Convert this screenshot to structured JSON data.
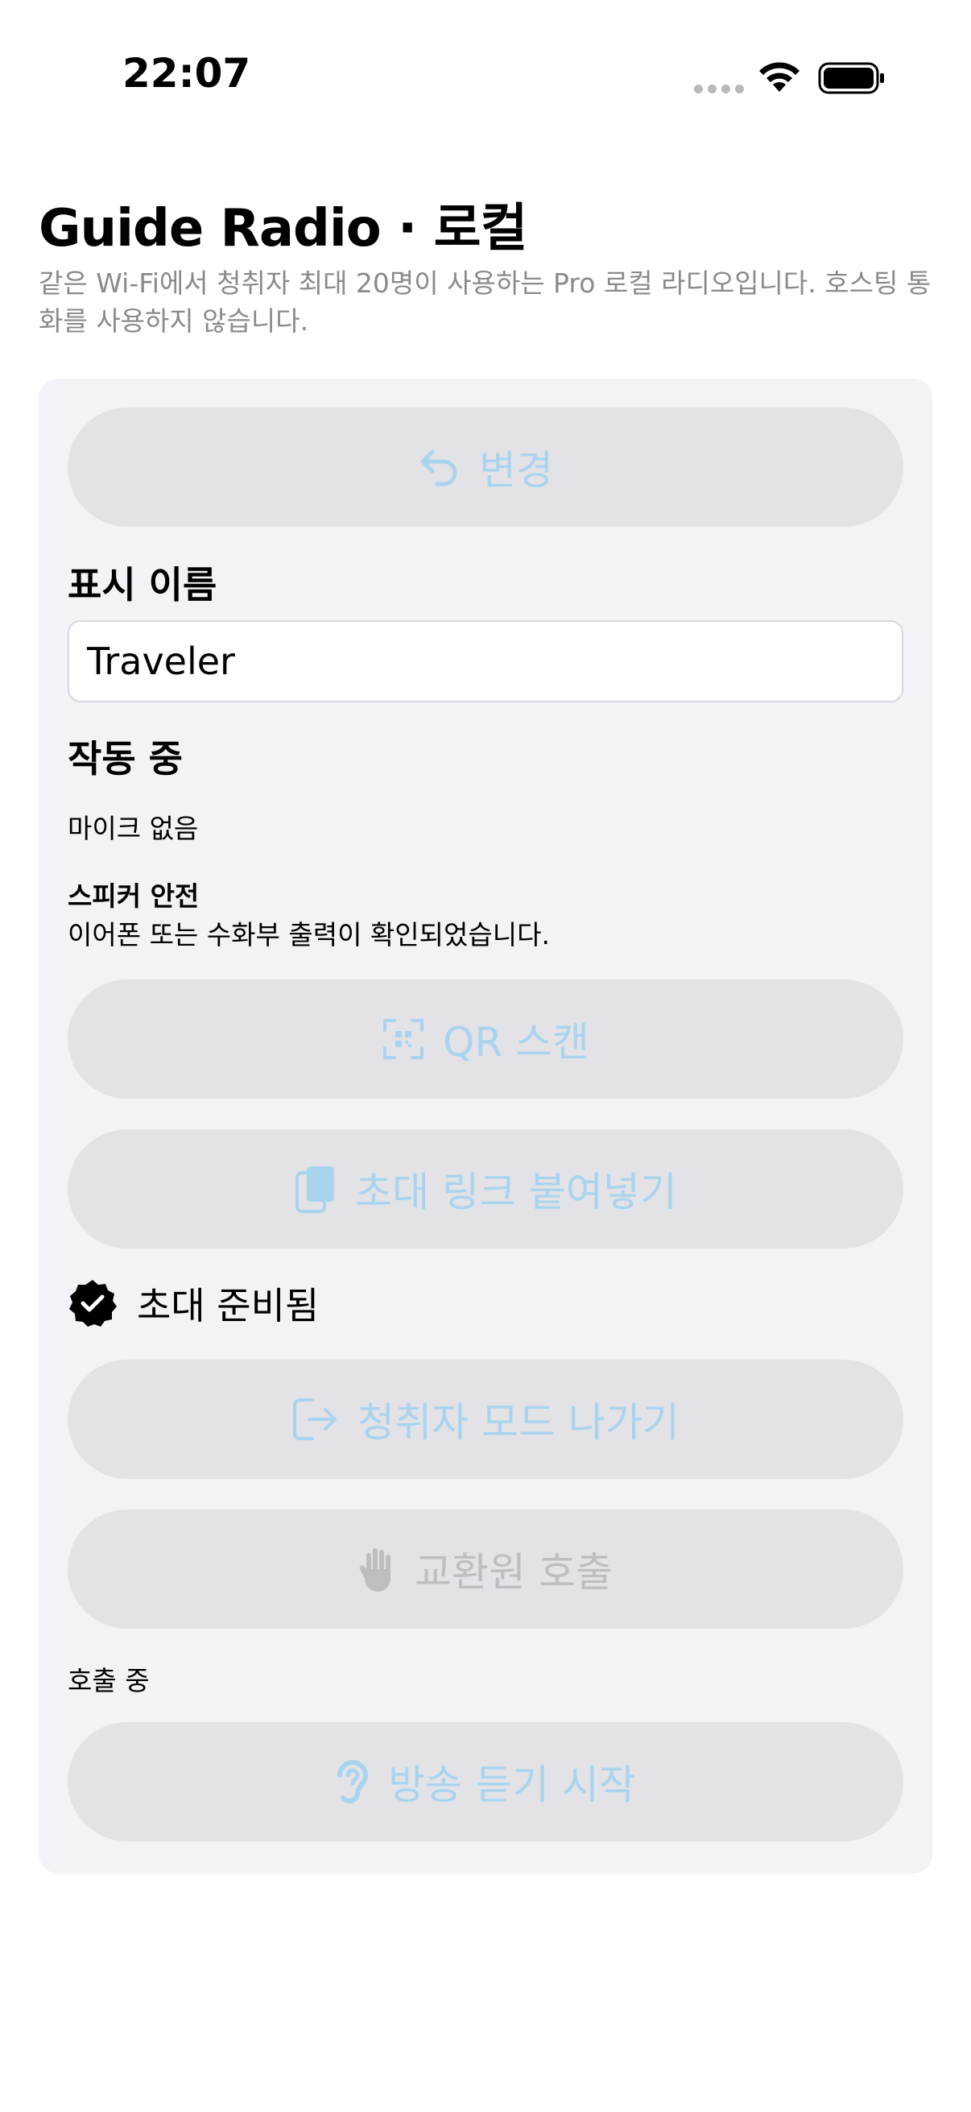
{
  "status_bar": {
    "time": "22:07"
  },
  "header": {
    "title": "Guide Radio · 로컬",
    "subtitle": "같은 Wi-Fi에서 청취자 최대 20명이 사용하는 Pro 로컬 라디오입니다. 호스팅 통화를 사용하지 않습니다."
  },
  "card": {
    "change_button": "변경",
    "display_name_label": "표시 이름",
    "display_name_value": "Traveler",
    "active_label": "작동 중",
    "mic_status": "마이크 없음",
    "speaker_title": "스피커 안전",
    "speaker_detail": "이어폰 또는 수화부 출력이 확인되었습니다.",
    "qr_scan_button": "QR 스캔",
    "paste_invite_button": "초대 링크 붙여넣기",
    "invite_ready": "초대 준비됨",
    "exit_listener_button": "청취자 모드 나가기",
    "call_operator_button": "교환원 호출",
    "calling_status": "호출 중",
    "start_listening_button": "방송 듣기 시작"
  },
  "colors": {
    "card_background": "#f2f2f7",
    "button_background": "#e2e2e7",
    "disabled_accent": "#a9d4ee",
    "disabled_gray": "#bdbdc2",
    "subtitle_gray": "#8a8a8e"
  }
}
